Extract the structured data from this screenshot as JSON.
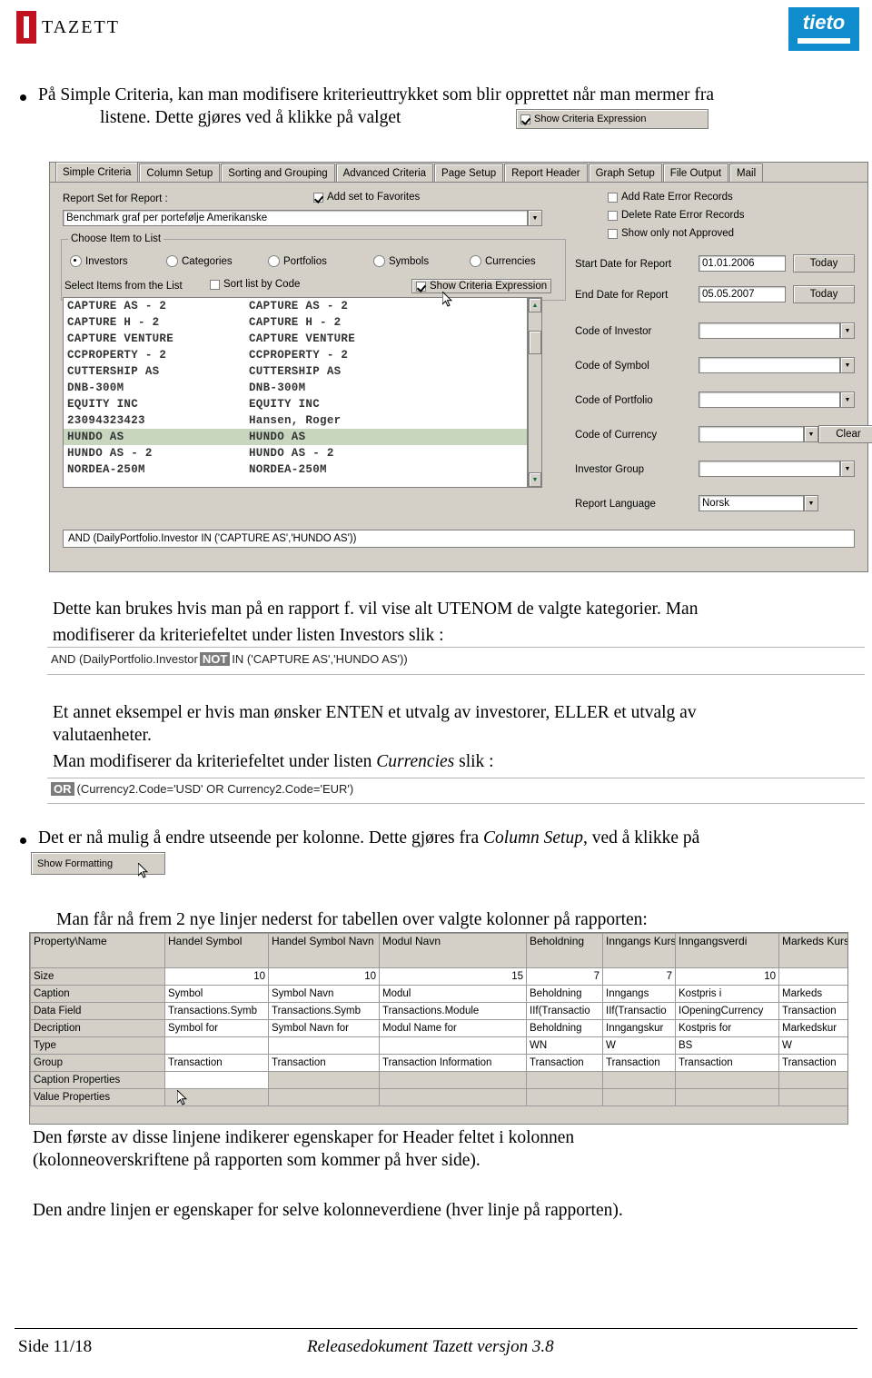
{
  "header": {
    "logo_text": "TAZETT",
    "brand_right": "tieto"
  },
  "body_text": {
    "bullet1_line1": "På Simple Criteria, kan man modifisere kriterieuttrykket som blir opprettet når man mermer fra",
    "bullet1_line2": "listene. Dette gjøres ved å klikke på valget",
    "para2_line1": "Dette kan brukes hvis man på en rapport f. vil vise alt UTENOM de valgte kategorier. Man",
    "para2_line2": "modifiserer da kriteriefeltet under listen Investors slik :",
    "para3_line1": "Et annet eksempel er hvis man ønsker ENTEN et utvalg av investorer, ELLER et utvalg av",
    "para3_line2": "valutaenheter.",
    "para3_line3_a": "Man modifiserer da kriteriefeltet under listen ",
    "para3_line3_it": "Currencies",
    "para3_line3_b": " slik :",
    "bullet2_a": "Det er nå mulig å endre utseende per kolonne. Dette gjøres fra ",
    "bullet2_it": "Column Setup",
    "bullet2_b": ", ved å klikke på",
    "para5": "Man får nå frem 2 nye linjer nederst for tabellen over valgte kolonner på rapporten:",
    "para6_line1": "Den første av disse linjene indikerer egenskaper for Header feltet i kolonnen",
    "para6_line2": "(kolonneoverskriftene på rapporten som kommer på hver side).",
    "para7": "Den andre linjen er egenskaper for selve kolonneverdiene (hver linje på rapporten)."
  },
  "inline_chips": {
    "show_criteria_expression": "Show Criteria Expression",
    "show_formatting": "Show Formatting"
  },
  "screenshot1": {
    "tabs": [
      "Simple Criteria",
      "Column Setup",
      "Sorting and Grouping",
      "Advanced Criteria",
      "Page Setup",
      "Report Header",
      "Graph Setup",
      "File Output",
      "Mail"
    ],
    "active_tab": "Simple Criteria",
    "report_set_label": "Report Set for Report :",
    "add_set_to_favorites": "Add set to Favorites",
    "report_set_value": "Benchmark graf per portefølje Amerikanske",
    "choose_item_group": "Choose Item to List",
    "radios": [
      "Investors",
      "Categories",
      "Portfolios",
      "Symbols",
      "Currencies"
    ],
    "radio_selected": "Investors",
    "select_items_label": "Select Items from the List",
    "sort_list_by_code": "Sort list by Code",
    "show_criteria_expression": "Show Criteria Expression",
    "list_rows": [
      {
        "code": "CAPTURE AS - 2",
        "name": "CAPTURE AS - 2",
        "selected": false
      },
      {
        "code": "CAPTURE H - 2",
        "name": "CAPTURE H - 2",
        "selected": false
      },
      {
        "code": "CAPTURE VENTURE",
        "name": "CAPTURE VENTURE",
        "selected": false
      },
      {
        "code": "CCPROPERTY - 2",
        "name": "CCPROPERTY - 2",
        "selected": false
      },
      {
        "code": "CUTTERSHIP AS",
        "name": "CUTTERSHIP AS",
        "selected": false
      },
      {
        "code": "DNB-300M",
        "name": "DNB-300M",
        "selected": false
      },
      {
        "code": "EQUITY INC",
        "name": "EQUITY INC",
        "selected": false
      },
      {
        "code": "23094323423",
        "name": "Hansen, Roger",
        "selected": false
      },
      {
        "code": "HUNDO AS",
        "name": "HUNDO AS",
        "selected": true
      },
      {
        "code": "HUNDO AS - 2",
        "name": "HUNDO AS - 2",
        "selected": false
      },
      {
        "code": "NORDEA-250M",
        "name": "NORDEA-250M",
        "selected": false
      }
    ],
    "criteria_expression": "AND (DailyPortfolio.Investor IN ('CAPTURE AS','HUNDO AS'))",
    "right_checks": [
      "Add Rate Error Records",
      "Delete Rate Error Records",
      "Show only not Approved"
    ],
    "right_fields": [
      {
        "label": "Start Date for Report",
        "value": "01.01.2006",
        "button": "Today"
      },
      {
        "label": "End Date for Report",
        "value": "05.05.2007",
        "button": "Today"
      },
      {
        "label": "Code of Investor",
        "value": ""
      },
      {
        "label": "Code of Symbol",
        "value": ""
      },
      {
        "label": "Code of Portfolio",
        "value": ""
      },
      {
        "label": "Code of Currency",
        "value": "",
        "button": "Clear"
      },
      {
        "label": "Investor Group",
        "value": ""
      },
      {
        "label": "Report Language",
        "value": "Norsk"
      }
    ]
  },
  "criteria_not": {
    "prefix": "AND (DailyPortfolio.Investor",
    "highlight": "NOT",
    "suffix": "IN ('CAPTURE AS','HUNDO AS'))"
  },
  "criteria_or": {
    "highlight": "OR",
    "text": "(Currency2.Code='USD' OR Currency2.Code='EUR')"
  },
  "column_table": {
    "headers": [
      "Property\\Name",
      "Handel Symbol",
      "Handel Symbol Navn",
      "Modul Navn",
      "Beholdning",
      "Inngangs Kurs",
      "Inngangsverdi",
      "Markeds Kurs"
    ],
    "rows": [
      {
        "label": "Size",
        "cells": [
          "10",
          "10",
          "15",
          "7",
          "7",
          "10",
          ""
        ],
        "numeric": true
      },
      {
        "label": "Caption",
        "cells": [
          "Symbol",
          "Symbol Navn",
          "Modul",
          "Beholdning",
          "Inngangs",
          "Kostpris i",
          "Markeds"
        ],
        "numeric": false
      },
      {
        "label": "Data Field",
        "cells": [
          "Transactions.Symb",
          "Transactions.Symb",
          "Transactions.Module",
          "IIf(Transactio",
          "IIf(Transactio",
          "IOpeningCurrency",
          "Transaction"
        ],
        "numeric": false
      },
      {
        "label": "Decription",
        "cells": [
          "Symbol for",
          "Symbol Navn for",
          "Modul Name for",
          "Beholdning",
          "Inngangskur",
          "Kostpris for",
          "Markedskur"
        ],
        "numeric": false
      },
      {
        "label": "Type",
        "cells": [
          "",
          "",
          "",
          "WN",
          "W",
          "BS",
          "W"
        ],
        "numeric": false
      },
      {
        "label": "Group",
        "cells": [
          "Transaction",
          "Transaction",
          "Transaction Information",
          "Transaction",
          "Transaction",
          "Transaction",
          "Transaction"
        ],
        "numeric": false
      },
      {
        "label": "Caption Properties",
        "cells": [
          "",
          "",
          "",
          "",
          "",
          "",
          ""
        ],
        "numeric": false
      },
      {
        "label": "Value Properties",
        "cells": [
          "",
          "",
          "",
          "",
          "",
          "",
          ""
        ],
        "numeric": false
      }
    ]
  },
  "footer": {
    "page": "Side 11/18",
    "doc": "Releasedokument Tazett versjon 3.8"
  }
}
